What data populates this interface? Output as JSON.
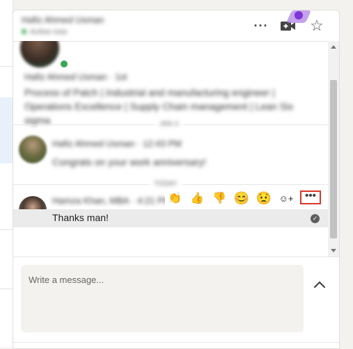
{
  "header": {
    "contact_name": "Hafiz Ahmed Usman",
    "status": "Active now",
    "more_icon": "more-horizontal-icon",
    "video_icon": "video-call-plus-icon",
    "star_icon": "star-outline-icon",
    "badge_color": "#7e36d6"
  },
  "thread": {
    "message1": {
      "sender": "Hafiz Ahmed Usman",
      "time": "1st",
      "text": "Process of Patch | Industrial and manufacturing engineer | Operations Excellence | Supply Chain management | Lean Six sigma"
    },
    "day_label_1": "JAN 4",
    "message2": {
      "sender": "Hafiz Ahmed Usman",
      "time": "12:43 PM",
      "text": "Congrats on your work anniversary!"
    },
    "day_label_2": "TODAY",
    "message3": {
      "sender": "Hamza Khan, MBA",
      "time": "4:21 PM",
      "text": "Thanks man!",
      "read_icon": "check-circle-icon"
    }
  },
  "reactions": {
    "items": [
      {
        "name": "clap-reaction-button",
        "glyph": "👏"
      },
      {
        "name": "thumbs-up-reaction-button",
        "glyph": "👍"
      },
      {
        "name": "thumbs-down-reaction-button",
        "glyph": "👎"
      },
      {
        "name": "smile-reaction-button",
        "glyph": "😊"
      },
      {
        "name": "sad-reaction-button",
        "glyph": "😟"
      },
      {
        "name": "add-reaction-button",
        "glyph": "☺+"
      }
    ],
    "more_label": "•••",
    "highlight_color": "#d9352a"
  },
  "compose": {
    "placeholder": "Write a message...",
    "collapse_icon": "chevron-up-icon"
  }
}
